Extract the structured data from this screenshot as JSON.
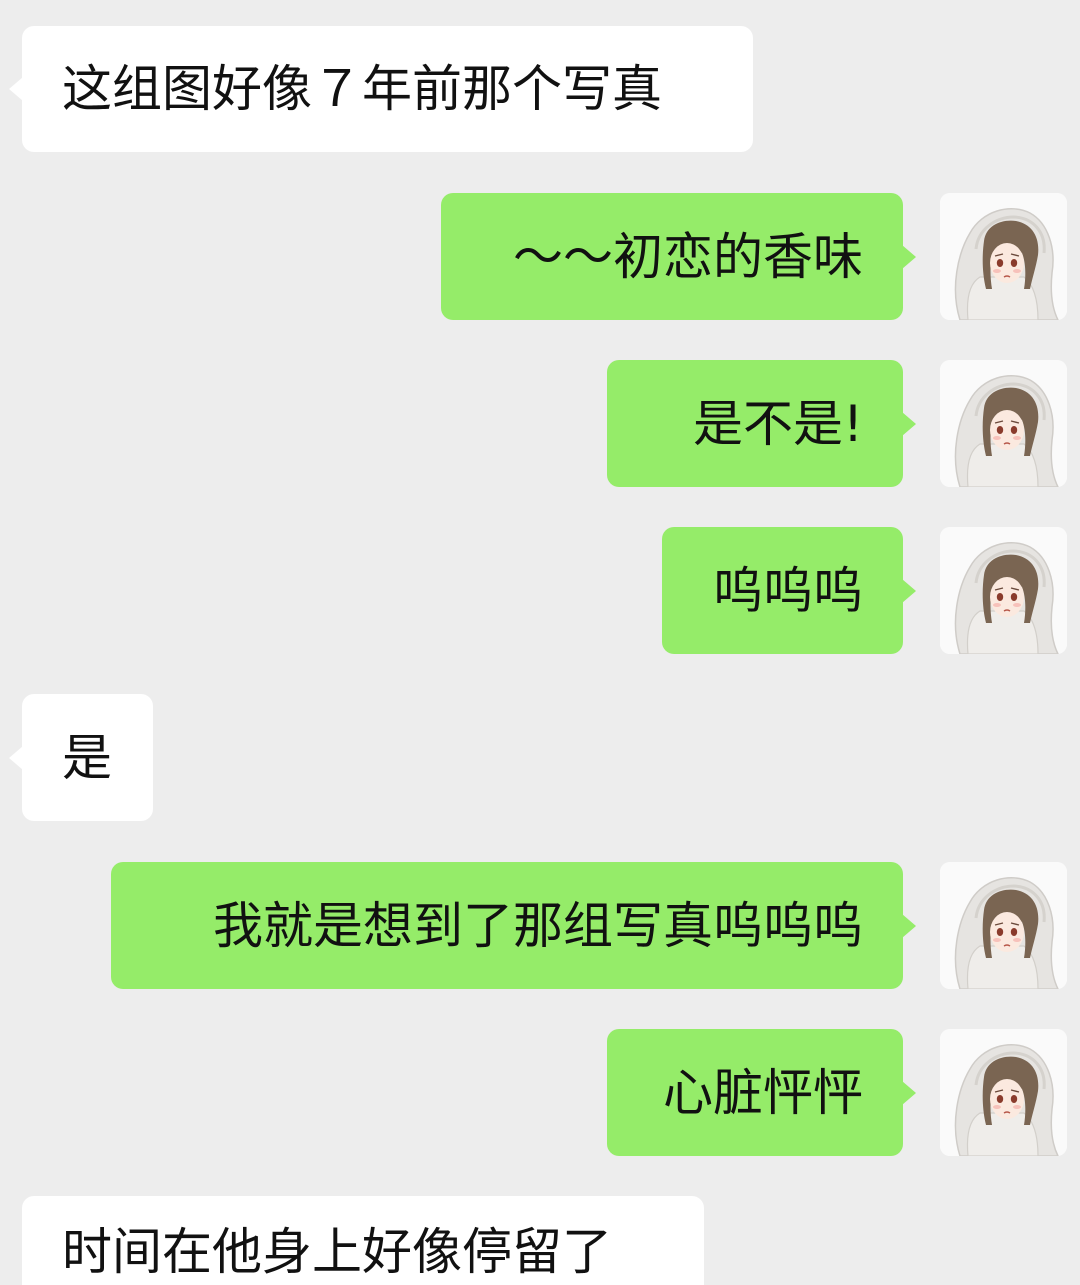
{
  "conversation": {
    "messages": [
      {
        "side": "received",
        "text": "这组图好像７年前那个写真"
      },
      {
        "side": "sent",
        "text": "～～初恋的香味"
      },
      {
        "side": "sent",
        "text": "是不是!"
      },
      {
        "side": "sent",
        "text": "呜呜呜"
      },
      {
        "side": "received",
        "text": "是"
      },
      {
        "side": "sent",
        "text": "我就是想到了那组写真呜呜呜"
      },
      {
        "side": "sent",
        "text": "心脏怦怦"
      },
      {
        "side": "received",
        "text": "时间在他身上好像停留了"
      }
    ]
  },
  "colors": {
    "background": "#ededed",
    "sent_bubble": "#95ec69",
    "received_bubble": "#ffffff",
    "text": "#111111"
  },
  "icons": {
    "sender_avatar": "anime-girl-white-hood-avatar"
  }
}
